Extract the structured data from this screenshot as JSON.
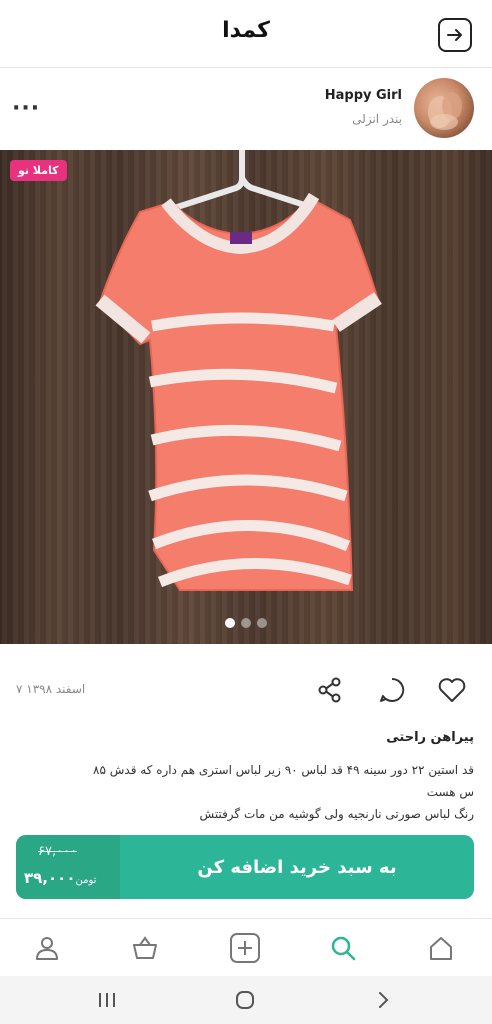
{
  "app": {
    "title": "کمدا"
  },
  "seller": {
    "name": "Happy Girl",
    "city": "بندر انزلی",
    "more_label": "···"
  },
  "photo": {
    "badge": "کاملا نو",
    "dots_count": 3,
    "active_dot": 0
  },
  "post": {
    "date": "۷ اسفند ۱۳۹۸"
  },
  "product": {
    "title": "پیراهن راحتی",
    "description_line1": "قد استین ۲۲ دور سینه ۴۹ قد لباس ۹۰ زیر لباس استری هم داره که قدش ۸۵",
    "description_line2": "س هست",
    "description_line3": "رنگ لباس صورتی نارنجیه ولی گوشیه من مات گرفتتش"
  },
  "cart": {
    "old_price": "۶۷,۰۰۰",
    "new_price": "۳۹,۰۰۰",
    "currency": "تومن",
    "button_label": "به سبد خرید اضافه کن"
  },
  "icons": {
    "back": "arrow-right-icon",
    "share": "share-icon",
    "comment": "comment-icon",
    "like": "heart-icon",
    "nav_profile": "user-icon",
    "nav_basket": "basket-icon",
    "nav_add": "plus-box-icon",
    "nav_search": "search-icon",
    "nav_home": "home-icon"
  },
  "colors": {
    "accent": "#2cb596",
    "accent_dark": "#2aa886",
    "badge": "#e8317f",
    "nav_active": "#2cb596"
  }
}
